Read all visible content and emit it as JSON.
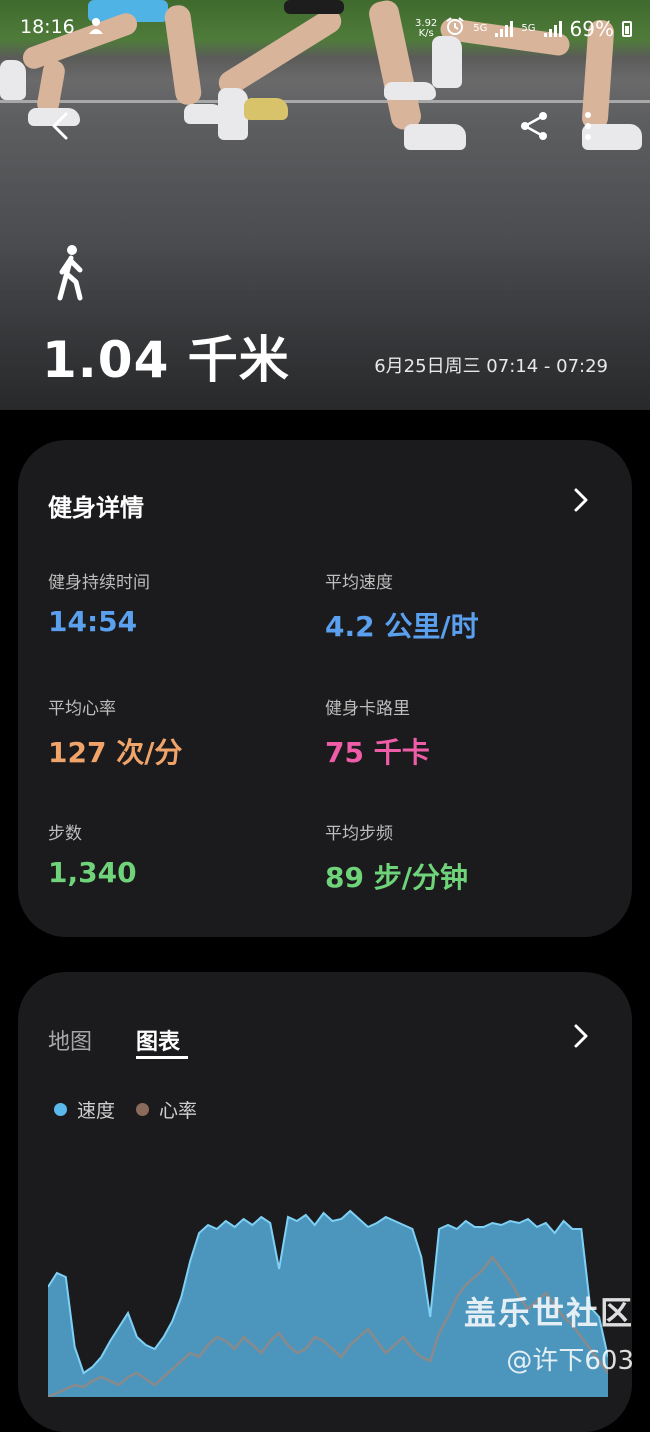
{
  "status_bar": {
    "time": "18:16",
    "network_speed_value": "3.92",
    "network_speed_unit": "K/s",
    "sim1": "5G",
    "sim2": "5G",
    "battery": "69%"
  },
  "header": {
    "back_icon": "back-arrow-icon",
    "share_icon": "share-icon",
    "more_icon": "more-vertical-icon",
    "activity_icon": "walking-person-icon",
    "distance": "1.04 千米",
    "datetime": "6月25日周三 07:14 - 07:29"
  },
  "details_card": {
    "title": "健身详情",
    "stats": [
      {
        "label": "健身持续时间",
        "value": "14:54",
        "color": "#5aa0ef"
      },
      {
        "label": "平均速度",
        "value": "4.2 公里/时",
        "color": "#5aa0ef"
      },
      {
        "label": "平均心率",
        "value": "127 次/分",
        "color": "#f0a46a"
      },
      {
        "label": "健身卡路里",
        "value": "75 千卡",
        "color": "#ef5da8"
      },
      {
        "label": "步数",
        "value": "1,340",
        "color": "#6fd37a"
      },
      {
        "label": "平均步频",
        "value": "89 步/分钟",
        "color": "#6fd37a"
      }
    ]
  },
  "chart_card": {
    "tabs": [
      {
        "label": "地图",
        "selected": false
      },
      {
        "label": "图表",
        "selected": true
      }
    ],
    "legend": [
      {
        "name": "速度",
        "color": "#5ab9ea"
      },
      {
        "name": "心率",
        "color": "#8a6a5a"
      }
    ]
  },
  "chart_data": {
    "type": "area",
    "series": [
      {
        "name": "速度",
        "values": [
          55,
          62,
          60,
          25,
          12,
          15,
          20,
          28,
          35,
          42,
          30,
          26,
          24,
          30,
          38,
          50,
          68,
          82,
          86,
          84,
          88,
          85,
          89,
          86,
          90,
          87,
          64,
          90,
          88,
          91,
          86,
          92,
          88,
          89,
          93,
          89,
          85,
          87,
          90,
          88,
          86,
          84,
          70,
          40,
          84,
          86,
          84,
          88,
          85,
          85,
          87,
          86,
          88,
          87,
          89,
          85,
          87,
          82,
          88,
          84,
          84,
          45,
          40,
          20
        ]
      },
      {
        "name": "心率",
        "values": [
          0,
          2,
          4,
          6,
          5,
          8,
          10,
          8,
          6,
          10,
          12,
          9,
          6,
          10,
          14,
          18,
          22,
          20,
          26,
          30,
          28,
          24,
          30,
          26,
          22,
          28,
          32,
          26,
          22,
          24,
          30,
          28,
          24,
          20,
          26,
          30,
          34,
          28,
          22,
          26,
          30,
          24,
          20,
          18,
          32,
          40,
          50,
          56,
          60,
          64,
          70,
          64,
          58,
          50,
          44,
          48,
          52,
          46,
          40,
          36,
          30,
          24,
          18,
          12
        ]
      }
    ],
    "ylim": [
      0,
      100
    ]
  },
  "watermark": {
    "line1": "盖乐世社区",
    "line2": "@许下603"
  }
}
